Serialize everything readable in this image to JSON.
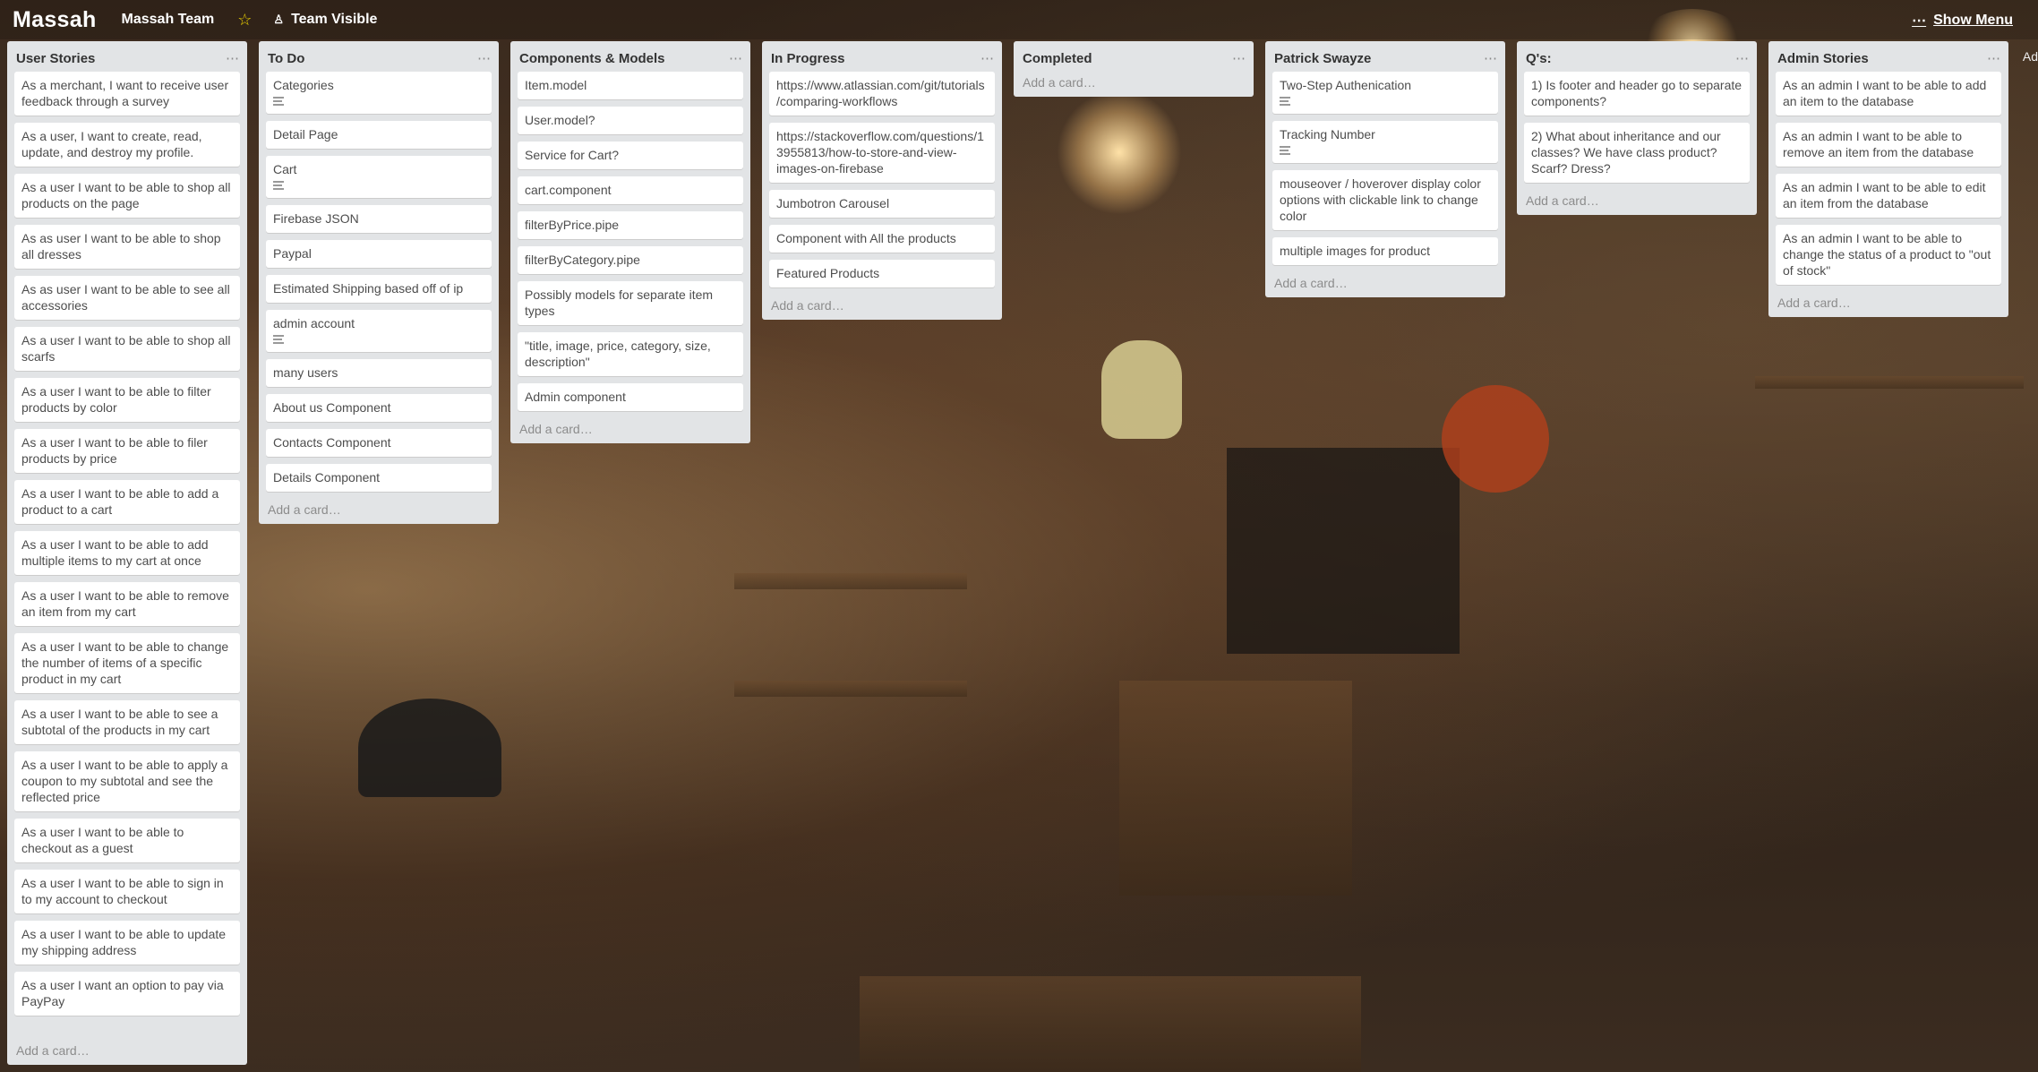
{
  "header": {
    "brand": "Massah",
    "team": "Massah Team",
    "star": "☆",
    "visibility_label": "Team Visible",
    "show_menu_label": "Show Menu",
    "edge_text": "Ad"
  },
  "add_card_label": "Add a card…",
  "lists": [
    {
      "title": "User Stories",
      "cards": [
        {
          "text": "As a merchant, I want to receive user feedback through a survey"
        },
        {
          "text": "As a user, I want to create, read, update, and destroy my profile."
        },
        {
          "text": "As a user I want to be able to shop all products on the page"
        },
        {
          "text": "As as user I want to be able to shop all dresses"
        },
        {
          "text": "As as user I want to be able to see all accessories"
        },
        {
          "text": "As a user I want to be able to shop all scarfs"
        },
        {
          "text": "As a user I want to be able to filter products by color"
        },
        {
          "text": "As a user I want to be able to filer products by price"
        },
        {
          "text": "As a user I want to be able to add a product to a cart"
        },
        {
          "text": "As a user I want to be able to add multiple items to my cart at once"
        },
        {
          "text": "As a user I want to be able to remove an item from my cart"
        },
        {
          "text": "As a user I want to be able to change the number of items of a specific product in my cart"
        },
        {
          "text": "As a user I want to be able to see a subtotal of the products in my cart"
        },
        {
          "text": "As a user I want to be able to apply a coupon to my subtotal and see the reflected price"
        },
        {
          "text": "As a user I want to be able to checkout as a guest"
        },
        {
          "text": "As a user I want to be able to sign in to my account to checkout"
        },
        {
          "text": "As a user I want to be able to update my shipping address"
        },
        {
          "text": "As a user I want an option to pay via PayPay"
        }
      ]
    },
    {
      "title": "To Do",
      "cards": [
        {
          "text": "Categories",
          "desc": true
        },
        {
          "text": "Detail Page"
        },
        {
          "text": "Cart",
          "desc": true
        },
        {
          "text": "Firebase JSON"
        },
        {
          "text": "Paypal"
        },
        {
          "text": "Estimated Shipping based off of ip"
        },
        {
          "text": "admin account",
          "desc": true
        },
        {
          "text": "many users"
        },
        {
          "text": "About us Component"
        },
        {
          "text": "Contacts Component"
        },
        {
          "text": "Details Component"
        }
      ]
    },
    {
      "title": "Components & Models",
      "cards": [
        {
          "text": "Item.model"
        },
        {
          "text": "User.model?"
        },
        {
          "text": "Service for Cart?"
        },
        {
          "text": "cart.component"
        },
        {
          "text": "filterByPrice.pipe"
        },
        {
          "text": "filterByCategory.pipe"
        },
        {
          "text": "Possibly models for separate item types"
        },
        {
          "text": "\"title, image, price, category, size, description\""
        },
        {
          "text": "Admin component"
        }
      ]
    },
    {
      "title": "In Progress",
      "cards": [
        {
          "text": "https://www.atlassian.com/git/tutorials/comparing-workflows"
        },
        {
          "text": "https://stackoverflow.com/questions/13955813/how-to-store-and-view-images-on-firebase"
        },
        {
          "text": "Jumbotron Carousel"
        },
        {
          "text": "Component with All the products"
        },
        {
          "text": "Featured Products"
        }
      ]
    },
    {
      "title": "Completed",
      "cards": []
    },
    {
      "title": "Patrick Swayze",
      "cards": [
        {
          "text": "Two-Step Authenication",
          "desc": true
        },
        {
          "text": "Tracking Number",
          "desc": true
        },
        {
          "text": "mouseover / hoverover display color options with clickable link to change color"
        },
        {
          "text": "multiple images for product"
        }
      ]
    },
    {
      "title": "Q's:",
      "cards": [
        {
          "text": "1) Is footer and header go to separate components?"
        },
        {
          "text": "2) What about inheritance and our classes? We have class product? Scarf? Dress?"
        }
      ]
    },
    {
      "title": "Admin Stories",
      "cards": [
        {
          "text": "As an admin I want to be able to add an item to the database"
        },
        {
          "text": "As an admin I want to be able to remove an item from the database"
        },
        {
          "text": "As an admin I want to be able to edit an item from the database"
        },
        {
          "text": "As an admin I want to be able to change the status of a product to \"out of stock\""
        }
      ]
    }
  ]
}
